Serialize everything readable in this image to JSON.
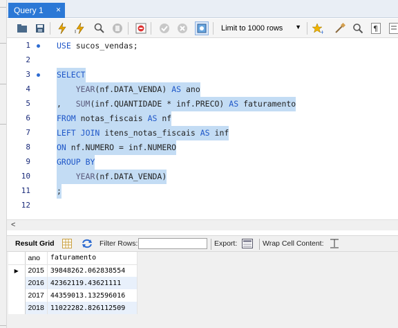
{
  "tab": {
    "label": "Query 1",
    "close": "×"
  },
  "toolbar": {
    "limit_value": "Limit to 1000 rows",
    "icons": [
      "open-folder-icon",
      "save-icon",
      "execute-icon",
      "execute-selection-icon",
      "explain-icon",
      "stop-icon",
      "toggle-error-icon",
      "commit-icon",
      "rollback-icon",
      "autocommit-icon",
      "bookmark-icon",
      "beautify-icon",
      "find-icon",
      "invisible-chars-icon",
      "word-wrap-icon"
    ]
  },
  "editor": {
    "lines": [
      {
        "num": "1",
        "text": "USE sucos_vendas;",
        "dot": true
      },
      {
        "num": "2",
        "text": "",
        "dot": false
      },
      {
        "num": "3",
        "text": "SELECT",
        "dot": true
      },
      {
        "num": "4",
        "text": "    YEAR(nf.DATA_VENDA) AS ano",
        "dot": false
      },
      {
        "num": "5",
        "text": ",   SUM(inf.QUANTIDADE * inf.PRECO) AS faturamento",
        "dot": false
      },
      {
        "num": "6",
        "text": "FROM notas_fiscais AS nf",
        "dot": false
      },
      {
        "num": "7",
        "text": "LEFT JOIN itens_notas_fiscais AS inf",
        "dot": false
      },
      {
        "num": "8",
        "text": "ON nf.NUMERO = inf.NUMERO",
        "dot": false
      },
      {
        "num": "9",
        "text": "GROUP BY",
        "dot": false
      },
      {
        "num": "10",
        "text": "    YEAR(nf.DATA_VENDA)",
        "dot": false
      },
      {
        "num": "11",
        "text": ";",
        "dot": false
      },
      {
        "num": "12",
        "text": "",
        "dot": false
      }
    ]
  },
  "result_bar": {
    "result_grid": "Result Grid",
    "filter_rows": "Filter Rows:",
    "export": "Export:",
    "wrap": "Wrap Cell Content:"
  },
  "grid": {
    "columns": [
      "ano",
      "faturamento"
    ],
    "rows": [
      [
        "2015",
        "39848262.062838554"
      ],
      [
        "2016",
        "42362119.43621111"
      ],
      [
        "2017",
        "44359013.132596016"
      ],
      [
        "2018",
        "11022282.826112509"
      ]
    ]
  }
}
